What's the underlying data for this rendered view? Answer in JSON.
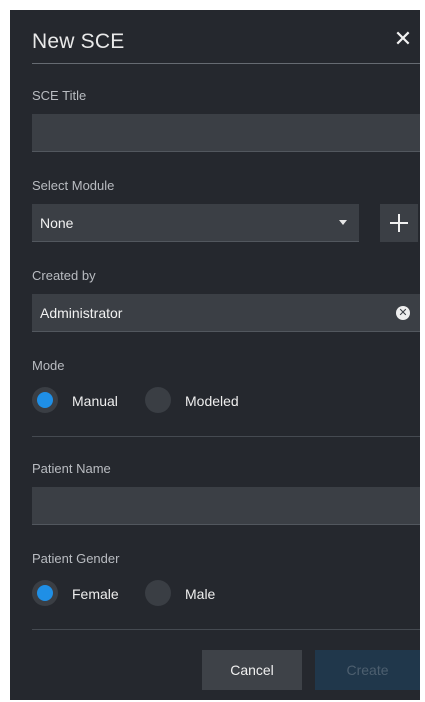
{
  "dialog": {
    "title": "New SCE",
    "close_icon": "close-icon"
  },
  "fields": {
    "sce_title": {
      "label": "SCE Title",
      "value": ""
    },
    "module": {
      "label": "Select Module",
      "value": "None",
      "add_icon": "plus-icon"
    },
    "created_by": {
      "label": "Created by",
      "value": "Administrator",
      "clear_icon": "clear-circle-icon"
    },
    "patient_name": {
      "label": "Patient Name",
      "value": ""
    }
  },
  "mode": {
    "label": "Mode",
    "options": [
      "Manual",
      "Modeled"
    ],
    "selected": "Manual"
  },
  "gender": {
    "label": "Patient Gender",
    "options": [
      "Female",
      "Male"
    ],
    "selected": "Female"
  },
  "buttons": {
    "cancel": "Cancel",
    "create": "Create"
  },
  "colors": {
    "background": "#25282e",
    "field": "#3b3f45",
    "accent": "#1f8fe6",
    "create_disabled": "#20374b"
  }
}
